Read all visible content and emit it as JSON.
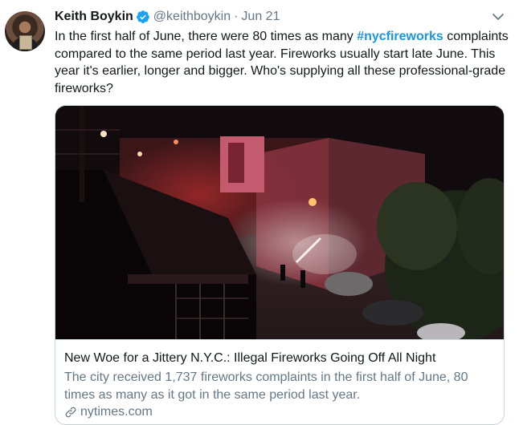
{
  "tweet": {
    "author": {
      "display_name": "Keith Boykin",
      "handle": "@keithboykin",
      "verified": true
    },
    "separator": "·",
    "date": "Jun 21",
    "text_before": "In the first half of June, there were 80 times as many ",
    "hashtag": "#nycfireworks",
    "text_after": " complaints compared to the same period last year. Fireworks usually start late June. This year it's earlier, longer and bigger. Who's supplying all these professional-grade fireworks?"
  },
  "card": {
    "title": "New Woe for a Jittery N.Y.C.: Illegal Fireworks Going Off All Night",
    "description": "The city received 1,737 fireworks complaints in the first half of June, 80 times as many as it got in the same period last year.",
    "domain": "nytimes.com"
  },
  "icons": {
    "verified": "verified-badge-icon",
    "caret": "chevron-down-icon",
    "link": "link-icon"
  },
  "colors": {
    "text": "#14171a",
    "secondary": "#657786",
    "accent": "#1b95e0",
    "border": "#ccd6dd"
  }
}
